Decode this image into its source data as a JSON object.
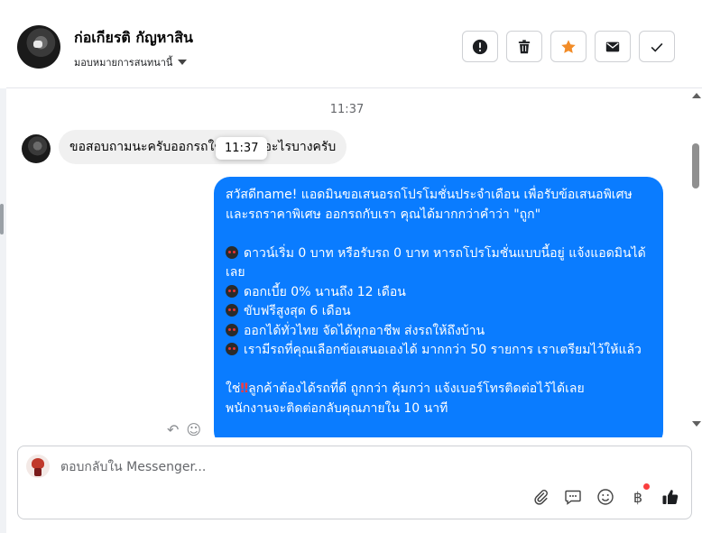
{
  "header": {
    "contact_name": "ก่อเกียรติ กัญหาสิน",
    "assign_label": "มอบหมายการสนทนานี้"
  },
  "toolbar": {
    "buttons": [
      "info-icon",
      "trash-icon",
      "star-icon",
      "mail-icon",
      "check-icon"
    ],
    "star_color": "#f28c28"
  },
  "conversation": {
    "timestamp": "11:37",
    "tooltip_time": "11:37",
    "incoming_message": "ขอสอบถามนะครับออกรถใช้เอกสารอะไรบางครับ",
    "outgoing": {
      "line1": "สวัสดีname! แอดมินขอเสนอรถโปรโมชั่นประจำเดือน เพื่อรับข้อเสนอพิเศษ และรถราคาพิเศษ ออกรถกับเรา คุณได้มากกว่าคำว่า \"ถูก\"",
      "bullet1": "ดาวน์เริ่ม 0 บาท หรือรับรถ 0 บาท หารถโปรโมชั่นแบบนี้อยู่ แจ้งแอดมินได้เลย",
      "bullet2": "ดอกเบี้ย 0% นานถึง 12 เดือน",
      "bullet3": "ขับฟรีสูงสุด 6 เดือน",
      "bullet4": "ออกได้ทั่วไทย จัดได้ทุกอาชีพ ส่งรถให้ถึงบ้าน",
      "bullet5": "เรามีรถที่คุณเลือกข้อเสนอเองได้ มากกว่า 50 รายการ เราเตรียมไว้ให้แล้ว",
      "closing_prefix": "ใช่",
      "closing_rest": "ลูกค้าต้องได้รถที่ดี ถูกกว่า คุ้มกว่า แจ้งเบอร์โทรติดต่อไว้ได้เลย",
      "closing_line2": "พนักงานจะติดต่อกลับคุณภายใน 10 นาที"
    },
    "bubble_color": "#0a7cff"
  },
  "composer": {
    "placeholder": "ตอบกลับใน Messenger...",
    "tools": [
      "paperclip-icon",
      "saved-reply-icon",
      "emoji-icon",
      "baht-icon",
      "thumbs-up-icon"
    ],
    "baht_symbol": "฿"
  }
}
